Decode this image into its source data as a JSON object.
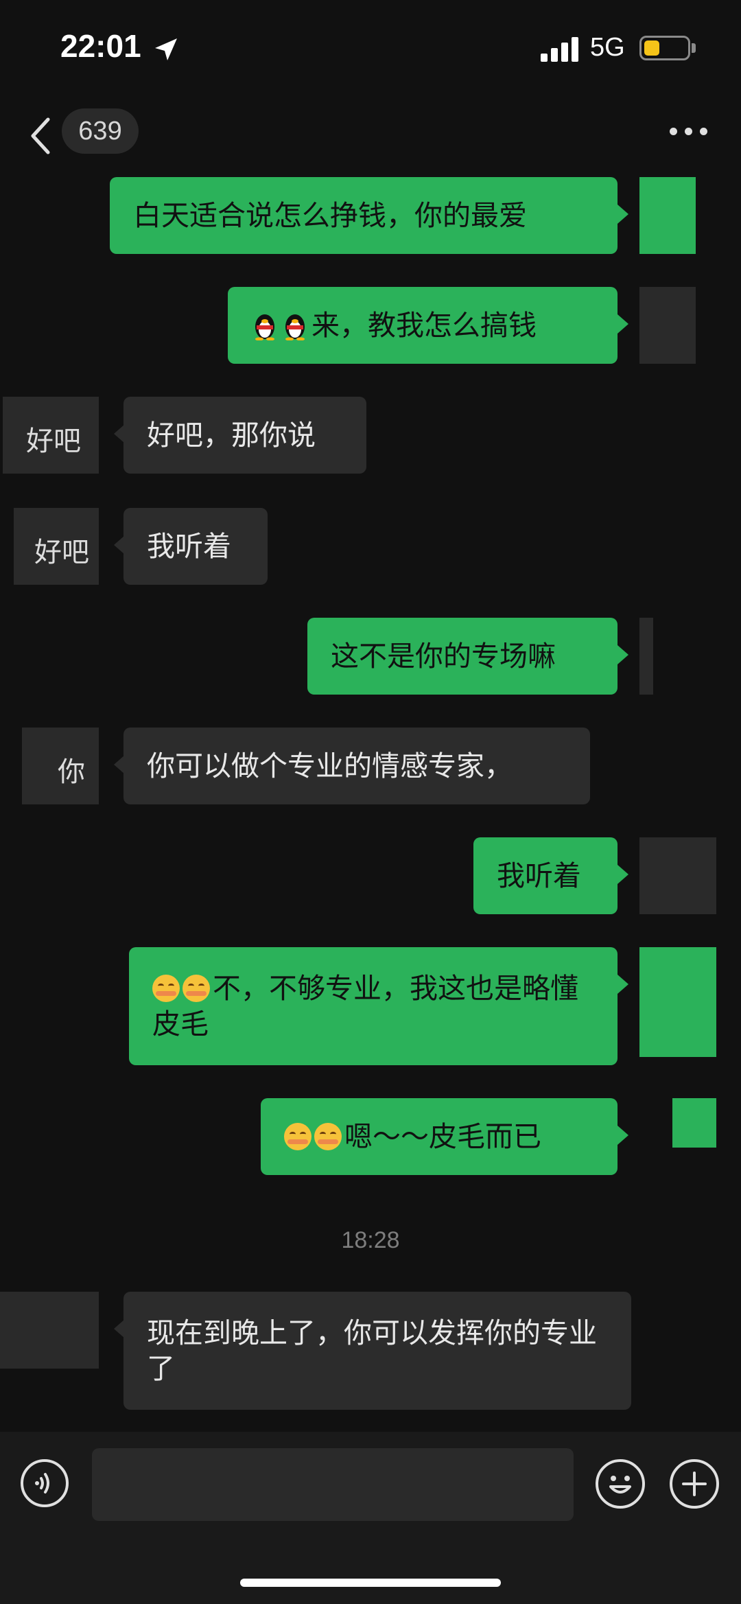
{
  "status_bar": {
    "time": "22:01",
    "network": "5G",
    "battery_level": 0.35,
    "battery_color": "#f5c419"
  },
  "nav": {
    "back_icon": "chevron-left-icon",
    "unread_count": "639",
    "more_icon": "more-dots-icon"
  },
  "colors": {
    "outgoing_bubble": "#2bb25a",
    "incoming_bubble": "#2c2c2c",
    "background": "#111111"
  },
  "messages": [
    {
      "direction": "out",
      "text": "白天适合说怎么挣钱，你的最爱"
    },
    {
      "direction": "out",
      "emoji": "qq-penguin-icon",
      "emoji_count": 2,
      "text": "来，教我怎么搞钱"
    },
    {
      "direction": "in",
      "sender_label": "好吧",
      "text": "好吧，那你说"
    },
    {
      "direction": "in",
      "sender_label": "好吧",
      "text": "我听着"
    },
    {
      "direction": "out",
      "text": "这不是你的专场嘛"
    },
    {
      "direction": "in",
      "sender_label": "你",
      "text": "你可以做个专业的情感专家，"
    },
    {
      "direction": "out",
      "text": "我听着"
    },
    {
      "direction": "out",
      "emoji": "blushing-smile-icon",
      "emoji_count": 2,
      "text": "不，不够专业，我这也是略懂皮毛"
    },
    {
      "direction": "out",
      "emoji": "blushing-smile-icon",
      "emoji_count": 2,
      "text": "嗯～～皮毛而已"
    },
    {
      "direction": "in",
      "text": "现在到晚上了，你可以发挥你的专业了"
    }
  ],
  "timestamp": "18:28",
  "input_bar": {
    "voice_icon": "voice-icon",
    "emoji_icon": "smiley-icon",
    "plus_icon": "plus-icon",
    "text_value": ""
  }
}
